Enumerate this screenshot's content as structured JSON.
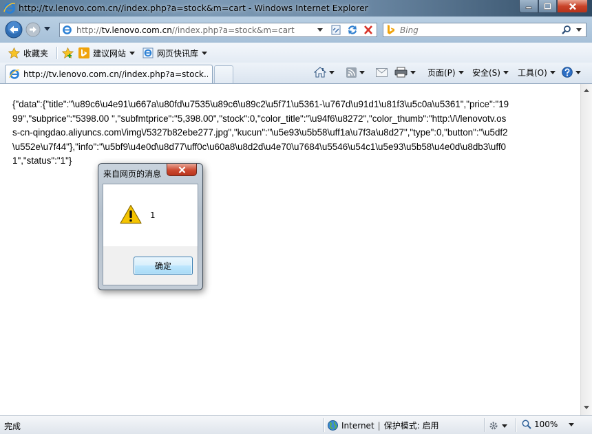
{
  "window": {
    "title": "http://tv.lenovo.com.cn//index.php?a=stock&m=cart - Windows Internet Explorer"
  },
  "address_bar": {
    "url_prefix": "http://",
    "url_host": "tv.lenovo.com.cn",
    "url_path": "//index.php?a=stock&m=cart"
  },
  "search": {
    "placeholder": "Bing"
  },
  "favorites_bar": {
    "favorites_label": "收藏夹",
    "suggested_sites_label": "建议网站",
    "web_slice_label": "网页快讯库"
  },
  "tab": {
    "label": "http://tv.lenovo.com.cn//index.php?a=stock..."
  },
  "command_bar": {
    "page_label": "页面(P)",
    "safety_label": "安全(S)",
    "tools_label": "工具(O)"
  },
  "content": {
    "json_text": "{\"data\":{\"title\":\"\\u89c6\\u4e91\\u667a\\u80fd\\u7535\\u89c6\\u89c2\\u5f71\\u5361-\\u767d\\u91d1\\u81f3\\u5c0a\\u5361\",\"price\":\"1999\",\"subprice\":\"5398.00 \",\"subfmtprice\":\"5,398.00\",\"stock\":0,\"color_title\":\"\\u94f6\\u8272\",\"color_thumb\":\"http:\\/\\/lenovotv.oss-cn-qingdao.aliyuncs.com\\/img\\/5327b82ebe277.jpg\",\"kucun\":\"\\u5e93\\u5b58\\uff1a\\u7f3a\\u8d27\",\"type\":0,\"button\":\"\\u5df2\\u552e\\u7f44\"},\"info\":\"\\u5bf9\\u4e0d\\u8d77\\uff0c\\u60a8\\u8d2d\\u4e70\\u7684\\u5546\\u54c1\\u5e93\\u5b58\\u4e0d\\u8db3\\uff01\",\"status\":\"1\"}"
  },
  "dialog": {
    "title": "来自网页的消息",
    "message": "1",
    "ok_label": "确定"
  },
  "status_bar": {
    "status_text": "完成",
    "zone": "Internet",
    "protected_mode": "保护模式: 启用",
    "zoom": "100%"
  },
  "colors": {
    "titlebar": "#6d8aa6",
    "close_button": "#c9442a",
    "ok_button_border": "#3c7fb1",
    "warning_yellow": "#f5c400"
  }
}
